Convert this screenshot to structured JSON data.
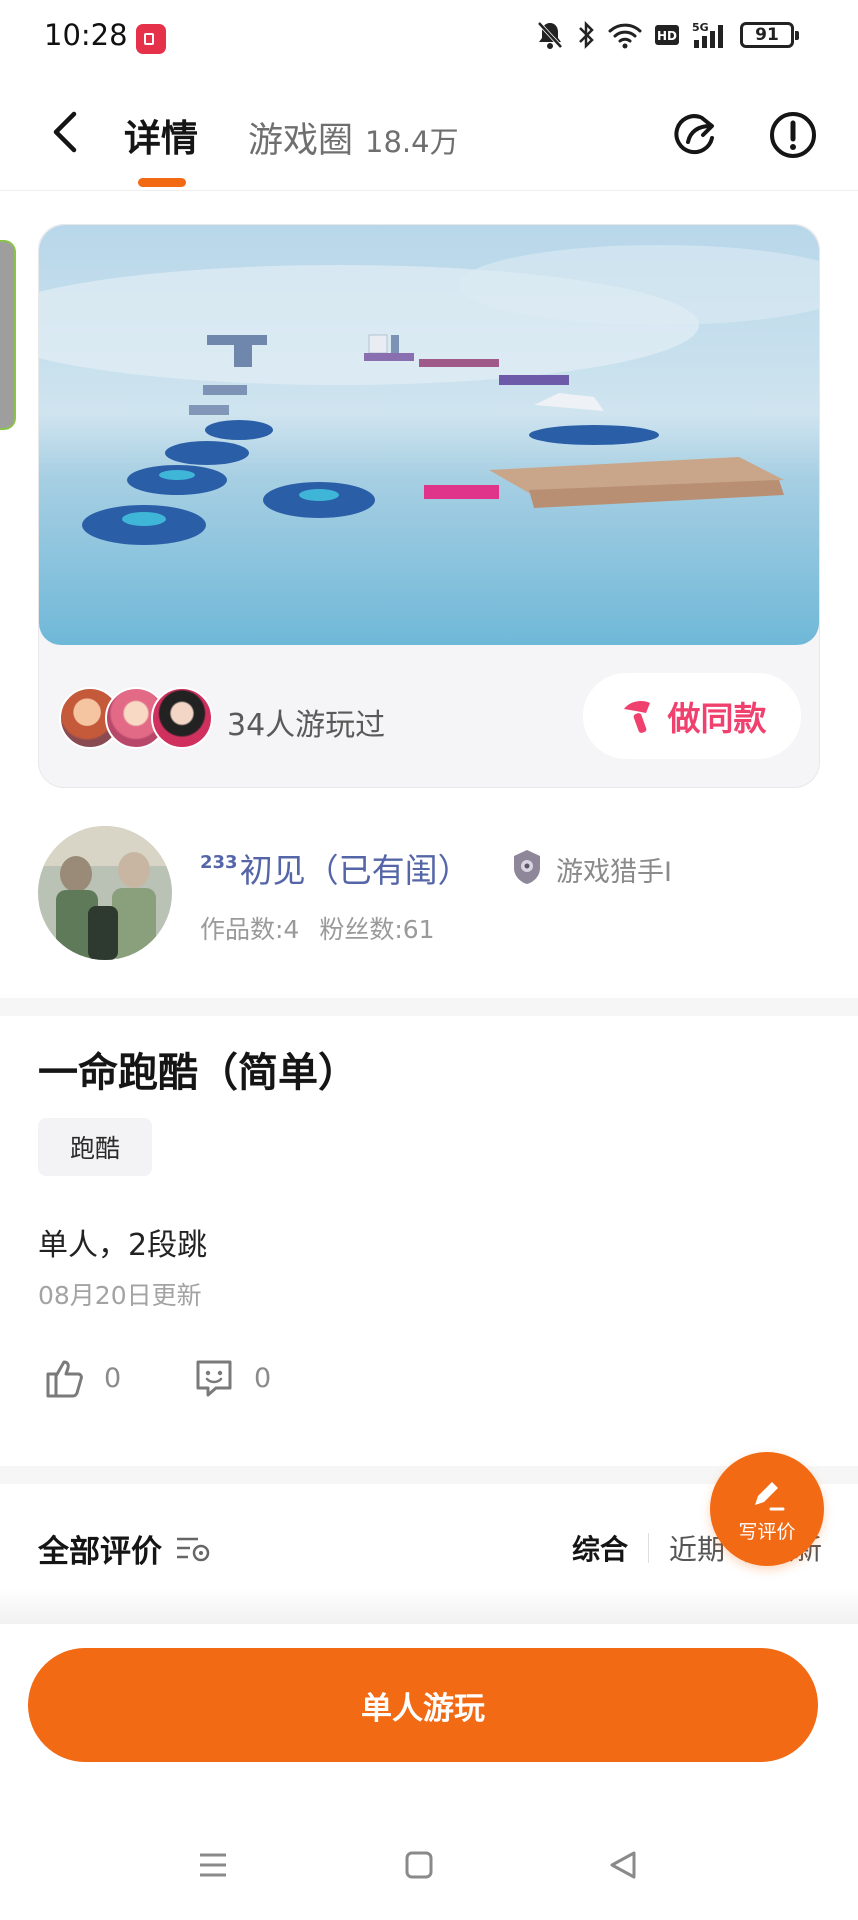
{
  "status_bar": {
    "time": "10:28",
    "battery": "91"
  },
  "header": {
    "tab_detail": "详情",
    "tab_circle": "游戏圈",
    "tab_circle_count": "18.4万",
    "accent": "#f26a14"
  },
  "preview": {
    "played_count_text": "34人游玩过",
    "make_same_label": "做同款"
  },
  "author": {
    "name_prefix": "233",
    "name": "初见（已有闺）",
    "badge_label": "游戏猎手I",
    "works": "作品数:4",
    "fans": "粉丝数:61"
  },
  "game": {
    "title": "一命跑酷（简单）",
    "tag": "跑酷",
    "description": "单人，2段跳",
    "updated": "08月20日更新",
    "likes": "0",
    "comments": "0"
  },
  "reviews": {
    "title": "全部评价",
    "sort_options": [
      "综合",
      "近期",
      "最新"
    ],
    "write_review": "写评价"
  },
  "actions": {
    "play_button": "单人游玩"
  }
}
